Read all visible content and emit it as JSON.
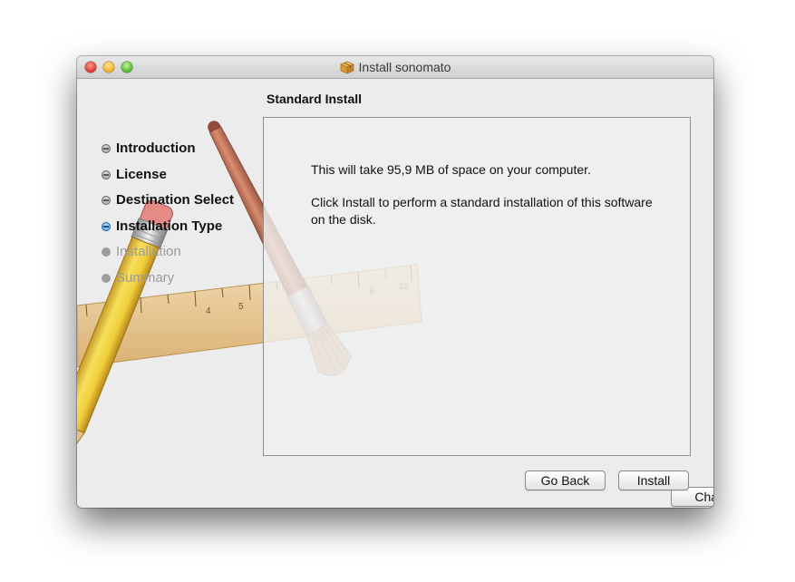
{
  "window": {
    "title": "Install sonomato",
    "title_icon": "package-icon",
    "controls": [
      "close",
      "minimize",
      "zoom"
    ]
  },
  "page": {
    "title": "Standard Install"
  },
  "steps": [
    {
      "label": "Introduction",
      "state": "done"
    },
    {
      "label": "License",
      "state": "done"
    },
    {
      "label": "Destination Select",
      "state": "done"
    },
    {
      "label": "Installation Type",
      "state": "current"
    },
    {
      "label": "Installation",
      "state": "pending"
    },
    {
      "label": "Summary",
      "state": "pending"
    }
  ],
  "content": {
    "line1": "This will take 95,9 MB of space on your computer.",
    "line2": "Click Install to perform a standard installation of this software on the disk."
  },
  "buttons": {
    "change_location": "Change Install Location…",
    "go_back": "Go Back",
    "install": "Install"
  },
  "colors": {
    "current_step_bullet": "#3d8de0",
    "window_background": "#ececec"
  }
}
